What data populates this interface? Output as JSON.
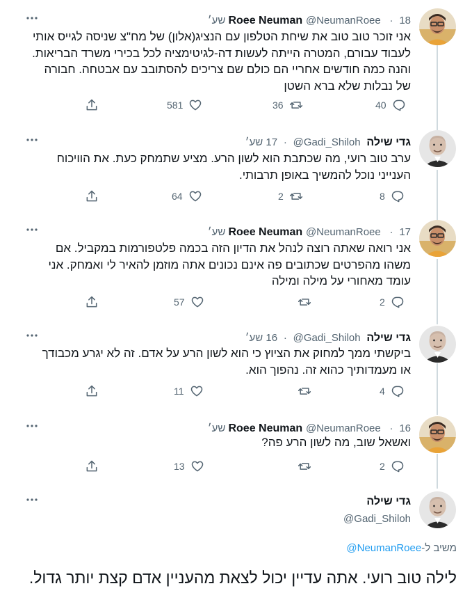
{
  "replies": [
    {
      "display_name": "Roee Neuman",
      "handle": "@NeumanRoee",
      "time": "18 שע׳",
      "text": "אני זוכר טוב טוב את שיחת הטלפון עם הנציג(אלון) של מח\"צ שניסה לגייס אותי לעבוד עבורם, המטרה הייתה לעשות דה-לגיטימציה לכל בכירי משרד הבריאות. והנה כמה חודשים אחריי הם כולם שם צריכים להסתובב עם אבטחה. חבורה של נבלות שלא ברא השטן",
      "replies_count": "40",
      "retweets_count": "36",
      "likes_count": "581"
    },
    {
      "display_name": "גדי שילה",
      "handle": "@Gadi_Shiloh",
      "time": "17 שע׳",
      "text": "ערב טוב רועי, מה שכתבת הוא לשון הרע. מציע שתמחק כעת. את הוויכוח הענייני נוכל להמשיך באופן תרבותי.",
      "replies_count": "8",
      "retweets_count": "2",
      "likes_count": "64"
    },
    {
      "display_name": "Roee Neuman",
      "handle": "@NeumanRoee",
      "time": "17 שע׳",
      "text": "אני רואה שאתה רוצה לנהל את הדיון הזה בכמה פלטפורמות במקביל. אם משהו מהפרטים שכתובים פה אינם נכונים אתה מוזמן להאיר לי ואמחק. אני עומד מאחורי על מילה ומילה",
      "replies_count": "2",
      "retweets_count": "",
      "likes_count": "57"
    },
    {
      "display_name": "גדי שילה",
      "handle": "@Gadi_Shiloh",
      "time": "16 שע׳",
      "text": "ביקשתי ממך למחוק את הציוץ כי הוא לשון הרע על אדם. זה לא יגרע מכבודך או מעמדותיך כהוא זה. נהפוך הוא.",
      "replies_count": "4",
      "retweets_count": "",
      "likes_count": "11"
    },
    {
      "display_name": "Roee Neuman",
      "handle": "@NeumanRoee",
      "time": "16 שע׳",
      "text": "ואשאל שוב, מה לשון הרע פה?",
      "replies_count": "2",
      "retweets_count": "",
      "likes_count": "13"
    }
  ],
  "main_tweet": {
    "display_name": "גדי שילה",
    "handle": "@Gadi_Shiloh",
    "replying_prefix": "משיב ל-",
    "replying_to": "@NeumanRoee",
    "text": "לילה טוב רועי. אתה עדיין יכול לצאת מהעניין אדם קצת יותר גדול."
  },
  "icons": {
    "more": "more-horizontal-icon",
    "reply": "reply-bubble-icon",
    "retweet": "retweet-icon",
    "like": "heart-icon",
    "share": "share-icon"
  },
  "colors": {
    "text_primary": "#0f1419",
    "text_secondary": "#536471",
    "link": "#1d9bf0",
    "thread_line": "#cfd9de"
  }
}
